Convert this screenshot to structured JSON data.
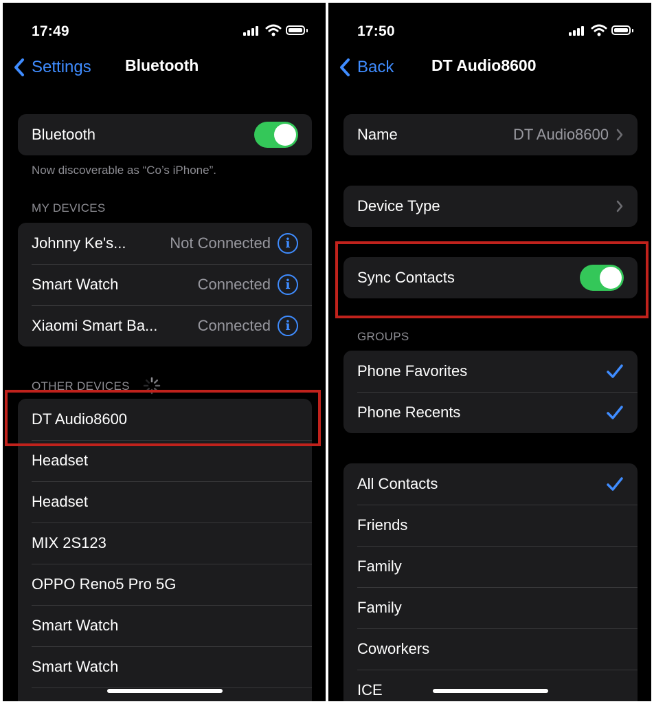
{
  "left_screen": {
    "status_bar": {
      "time": "17:49"
    },
    "nav": {
      "back_label": "Settings",
      "title": "Bluetooth"
    },
    "bluetooth_toggle": {
      "label": "Bluetooth",
      "state": "on"
    },
    "discoverable_text": "Now discoverable as “Co’s iPhone”.",
    "my_devices": {
      "header": "MY DEVICES",
      "items": [
        {
          "name": "Johnny Ke's...",
          "status": "Not Connected"
        },
        {
          "name": "Smart Watch",
          "status": "Connected"
        },
        {
          "name": "Xiaomi Smart Ba...",
          "status": "Connected"
        }
      ]
    },
    "other_devices": {
      "header": "OTHER DEVICES",
      "items": [
        {
          "name": "DT Audio8600"
        },
        {
          "name": "Headset"
        },
        {
          "name": "Headset"
        },
        {
          "name": "MIX 2S123"
        },
        {
          "name": "OPPO Reno5 Pro 5G"
        },
        {
          "name": "Smart Watch"
        },
        {
          "name": "Smart Watch"
        }
      ]
    }
  },
  "right_screen": {
    "status_bar": {
      "time": "17:50"
    },
    "nav": {
      "back_label": "Back",
      "title": "DT Audio8600"
    },
    "name_row": {
      "label": "Name",
      "value": "DT Audio8600"
    },
    "device_type_row": {
      "label": "Device Type"
    },
    "sync_contacts": {
      "label": "Sync Contacts",
      "state": "on"
    },
    "groups": {
      "header": "GROUPS",
      "items": [
        {
          "label": "Phone Favorites",
          "checked": true
        },
        {
          "label": "Phone Recents",
          "checked": true
        }
      ]
    },
    "contacts": {
      "items": [
        {
          "label": "All Contacts",
          "checked": true
        },
        {
          "label": "Friends",
          "checked": false
        },
        {
          "label": "Family",
          "checked": false
        },
        {
          "label": "Family",
          "checked": false
        },
        {
          "label": "Coworkers",
          "checked": false
        },
        {
          "label": "ICE",
          "checked": false
        }
      ]
    }
  },
  "colors": {
    "accent_blue": "#3f8cff",
    "toggle_green": "#34c759",
    "highlight_red": "#c0221c",
    "background": "#000000",
    "cell_background": "#1c1c1e"
  },
  "icons": [
    "chevron-left-icon",
    "info-icon",
    "checkmark-icon",
    "chevron-right-icon",
    "cellular-signal-icon",
    "wifi-icon",
    "battery-icon",
    "activity-spinner-icon"
  ]
}
